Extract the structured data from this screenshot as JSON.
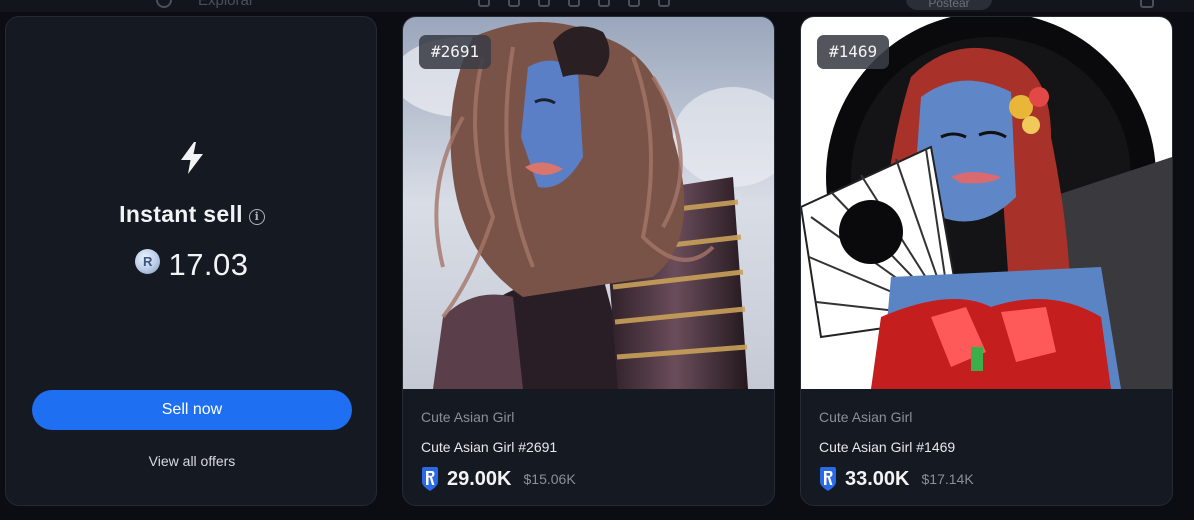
{
  "topbar": {
    "search_placeholder": "Explorar",
    "post_label": "Postear"
  },
  "instant_sell": {
    "title": "Instant sell",
    "price": "17.03",
    "sell_button": "Sell now",
    "view_offers": "View all offers"
  },
  "cards": [
    {
      "token_id": "#2691",
      "collection": "Cute Asian Girl",
      "name": "Cute Asian Girl #2691",
      "price": "29.00K",
      "fiat": "$15.06K"
    },
    {
      "token_id": "#1469",
      "collection": "Cute Asian Girl",
      "name": "Cute Asian Girl #1469",
      "price": "33.00K",
      "fiat": "$17.14K"
    }
  ],
  "colors": {
    "accent": "#1f6ff2",
    "panel": "#151922",
    "background": "#0b0d12",
    "muted_text": "#8a8f98",
    "currency_blue": "#2a6ae8"
  },
  "icons": [
    "search-icon",
    "bolt-icon",
    "info-icon",
    "ronin-coin-icon",
    "ronin-token-icon"
  ]
}
